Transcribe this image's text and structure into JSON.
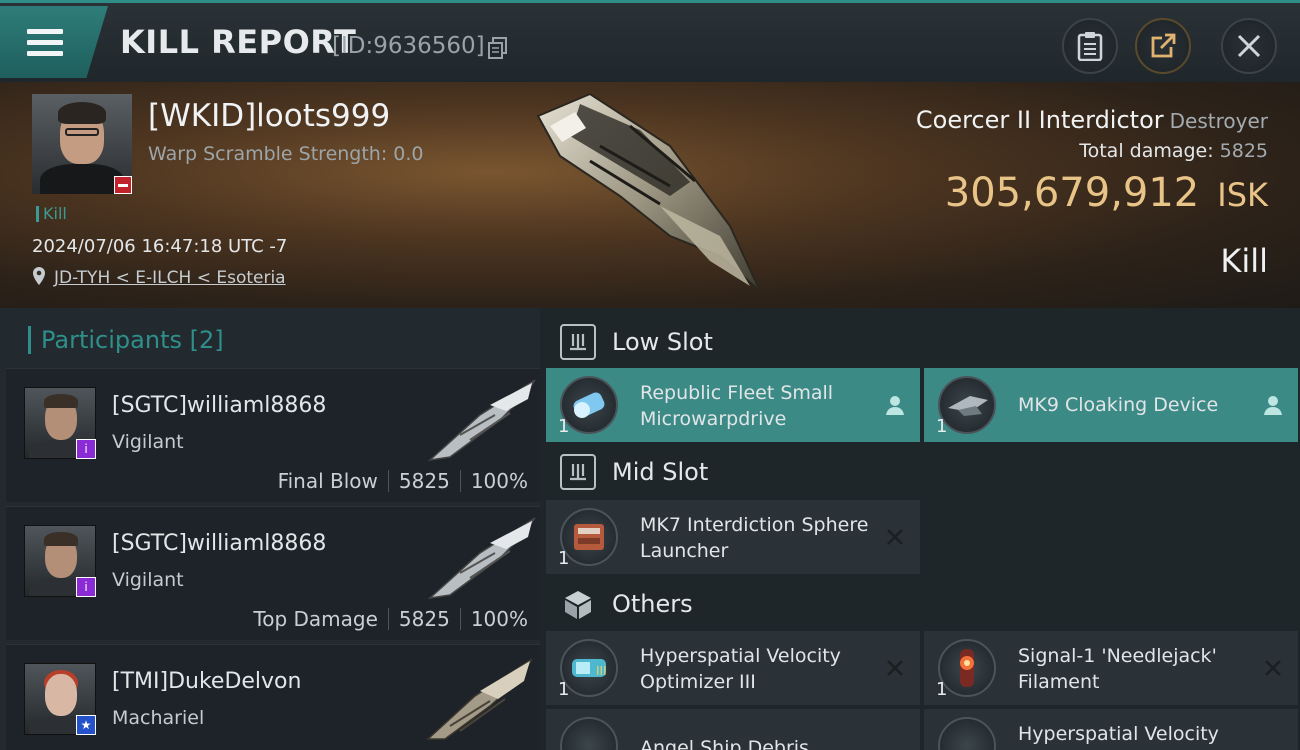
{
  "header": {
    "title": "KILL REPORT",
    "report_id": "[ID:9636560]"
  },
  "victim": {
    "name": "[WKID]loots999",
    "warp_scramble": "Warp Scramble Strength: 0.0",
    "kill_tag": "Kill",
    "timestamp": "2024/07/06 16:47:18 UTC -7",
    "location": "JD-TYH < E-ILCH < Esoteria",
    "ship_name": "Coercer II Interdictor",
    "ship_class": "Destroyer",
    "total_damage_label": "Total damage:",
    "total_damage": "5825",
    "isk_value": "305,679,912",
    "isk_unit": "ISK",
    "result": "Kill"
  },
  "participants": {
    "header": "Participants [2]",
    "rows": [
      {
        "name": "[SGTC]williaml8868",
        "ship": "Vigilant",
        "role": "Final Blow",
        "damage": "5825",
        "percent": "100%",
        "badge": "i"
      },
      {
        "name": "[SGTC]williaml8868",
        "ship": "Vigilant",
        "role": "Top Damage",
        "damage": "5825",
        "percent": "100%",
        "badge": "i"
      },
      {
        "name": "[TMI]DukeDelvon",
        "ship": "Machariel",
        "badge": "★"
      }
    ]
  },
  "fitting": {
    "low_slot": {
      "label": "Low Slot",
      "modules": [
        {
          "name": "Republic Fleet Small Microwarpdrive",
          "qty": "1",
          "state": "dropped"
        },
        {
          "name": "MK9 Cloaking Device",
          "qty": "1",
          "state": "dropped"
        }
      ]
    },
    "mid_slot": {
      "label": "Mid Slot",
      "modules": [
        {
          "name": "MK7 Interdiction Sphere Launcher",
          "qty": "1",
          "state": "destroyed"
        }
      ]
    },
    "others": {
      "label": "Others",
      "modules": [
        {
          "name": "Hyperspatial Velocity Optimizer III",
          "qty": "1",
          "state": "destroyed"
        },
        {
          "name": "Signal-1 'Needlejack' Filament",
          "qty": "1",
          "state": "destroyed"
        },
        {
          "name": "Angel Ship Debris"
        },
        {
          "name": "Hyperspatial Velocity"
        }
      ]
    }
  },
  "colors": {
    "accent_teal": "#3c8a86",
    "isk_gold": "#e9c488",
    "kill_badge_red": "#c2222a",
    "corp_badge_purple": "#8a2bd6",
    "corp_badge_blue": "#2552c8"
  },
  "icons": [
    "menu-icon",
    "copy-icon",
    "clipboard-icon",
    "share-icon",
    "close-icon",
    "location-pin-icon",
    "slot-low-icon",
    "slot-mid-icon",
    "cube-icon",
    "person-icon",
    "x-icon"
  ]
}
